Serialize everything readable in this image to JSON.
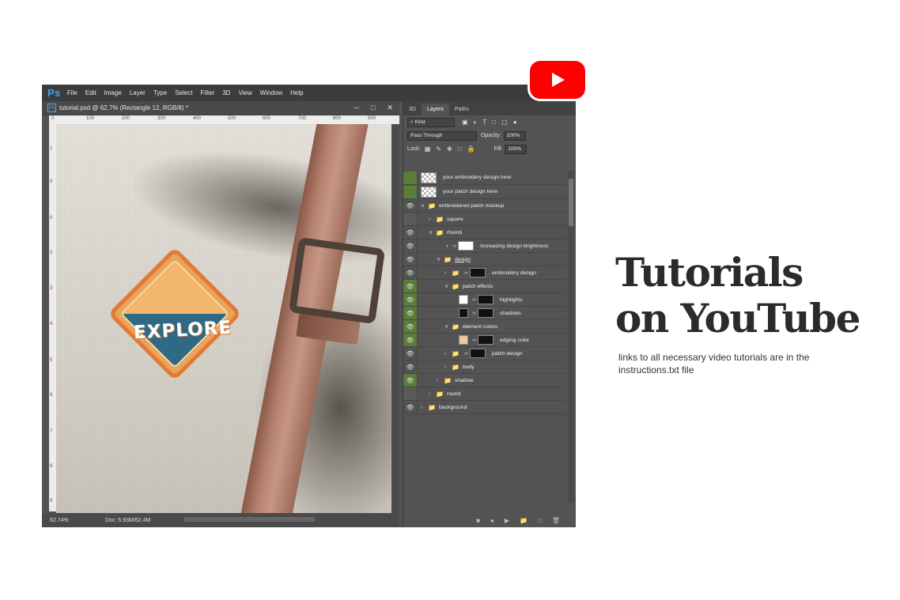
{
  "app": {
    "logo": "Ps",
    "menu": [
      "File",
      "Edit",
      "Image",
      "Layer",
      "Type",
      "Select",
      "Filter",
      "3D",
      "View",
      "Window",
      "Help"
    ],
    "document_tab": "tutorial.psd @ 62.7% (Rectangle 12, RGB/8) *",
    "ruler_top": [
      "0",
      "100",
      "200",
      "300",
      "400",
      "500",
      "600",
      "700",
      "800",
      "900"
    ],
    "ruler_left": [
      "1",
      "0",
      "0",
      "2",
      "3",
      "4",
      "5",
      "6",
      "7",
      "8",
      "9"
    ],
    "status": {
      "zoom": "62.74%",
      "doc_size": "Doc: 5.93M/62.4M"
    },
    "canvas_text": "EXPLORE"
  },
  "panel": {
    "tabs": [
      "3D",
      "Layers",
      "Paths"
    ],
    "active_tab": "Layers",
    "filter_kind": "Kind",
    "blend_mode": "Pass Through",
    "opacity_label": "Opacity:",
    "opacity_value": "100%",
    "lock_label": "Lock:",
    "fill_label": "Fill:",
    "fill_value": "100%",
    "layers": [
      {
        "name": "your embroidery design here"
      },
      {
        "name": "your patch design here"
      },
      {
        "name": "embroidered patch mockup"
      },
      {
        "name": "square"
      },
      {
        "name": "rhomb"
      },
      {
        "name": "increasing design brightness"
      },
      {
        "name": "design"
      },
      {
        "name": "embroidery design"
      },
      {
        "name": "patch effects"
      },
      {
        "name": "highlights"
      },
      {
        "name": "shadows"
      },
      {
        "name": "element colors"
      },
      {
        "name": "edging color"
      },
      {
        "name": "patch design"
      },
      {
        "name": "body"
      },
      {
        "name": "shadow"
      },
      {
        "name": "round"
      },
      {
        "name": "background"
      }
    ]
  },
  "promo": {
    "title_line1": "Tutorials",
    "title_line2": "on YouTube",
    "description": "links to all necessary video tutorials are in the instructions.txt file",
    "youtube_color": "#ff0000"
  }
}
